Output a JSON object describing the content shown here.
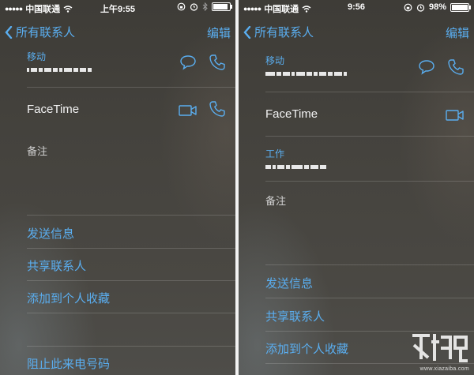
{
  "left": {
    "status": {
      "carrier": "中国联通",
      "time": "上午9:55"
    },
    "nav": {
      "back_label": "所有联系人",
      "edit_label": "编辑"
    },
    "mobile": {
      "label": "移动"
    },
    "facetime": {
      "label": "FaceTime"
    },
    "notes": {
      "label": "备注"
    },
    "actions": {
      "send_message": "发送信息",
      "share_contact": "共享联系人",
      "add_favorite": "添加到个人收藏",
      "block_caller": "阻止此来电号码"
    }
  },
  "right": {
    "status": {
      "carrier": "中国联通",
      "time": "9:56",
      "battery": "98%",
      "battery_level": 0.98
    },
    "nav": {
      "back_label": "所有联系人",
      "edit_label": "编辑"
    },
    "mobile": {
      "label": "移动"
    },
    "facetime": {
      "label": "FaceTime"
    },
    "work": {
      "label": "工作"
    },
    "notes": {
      "label": "备注"
    },
    "actions": {
      "send_message": "发送信息",
      "share_contact": "共享联系人",
      "add_favorite": "添加到个人收藏"
    }
  },
  "watermark": {
    "url": "www.xiazaiba.com"
  },
  "colors": {
    "accent": "#5aaef0",
    "background": "#45433e",
    "text": "#f2f2f2"
  }
}
